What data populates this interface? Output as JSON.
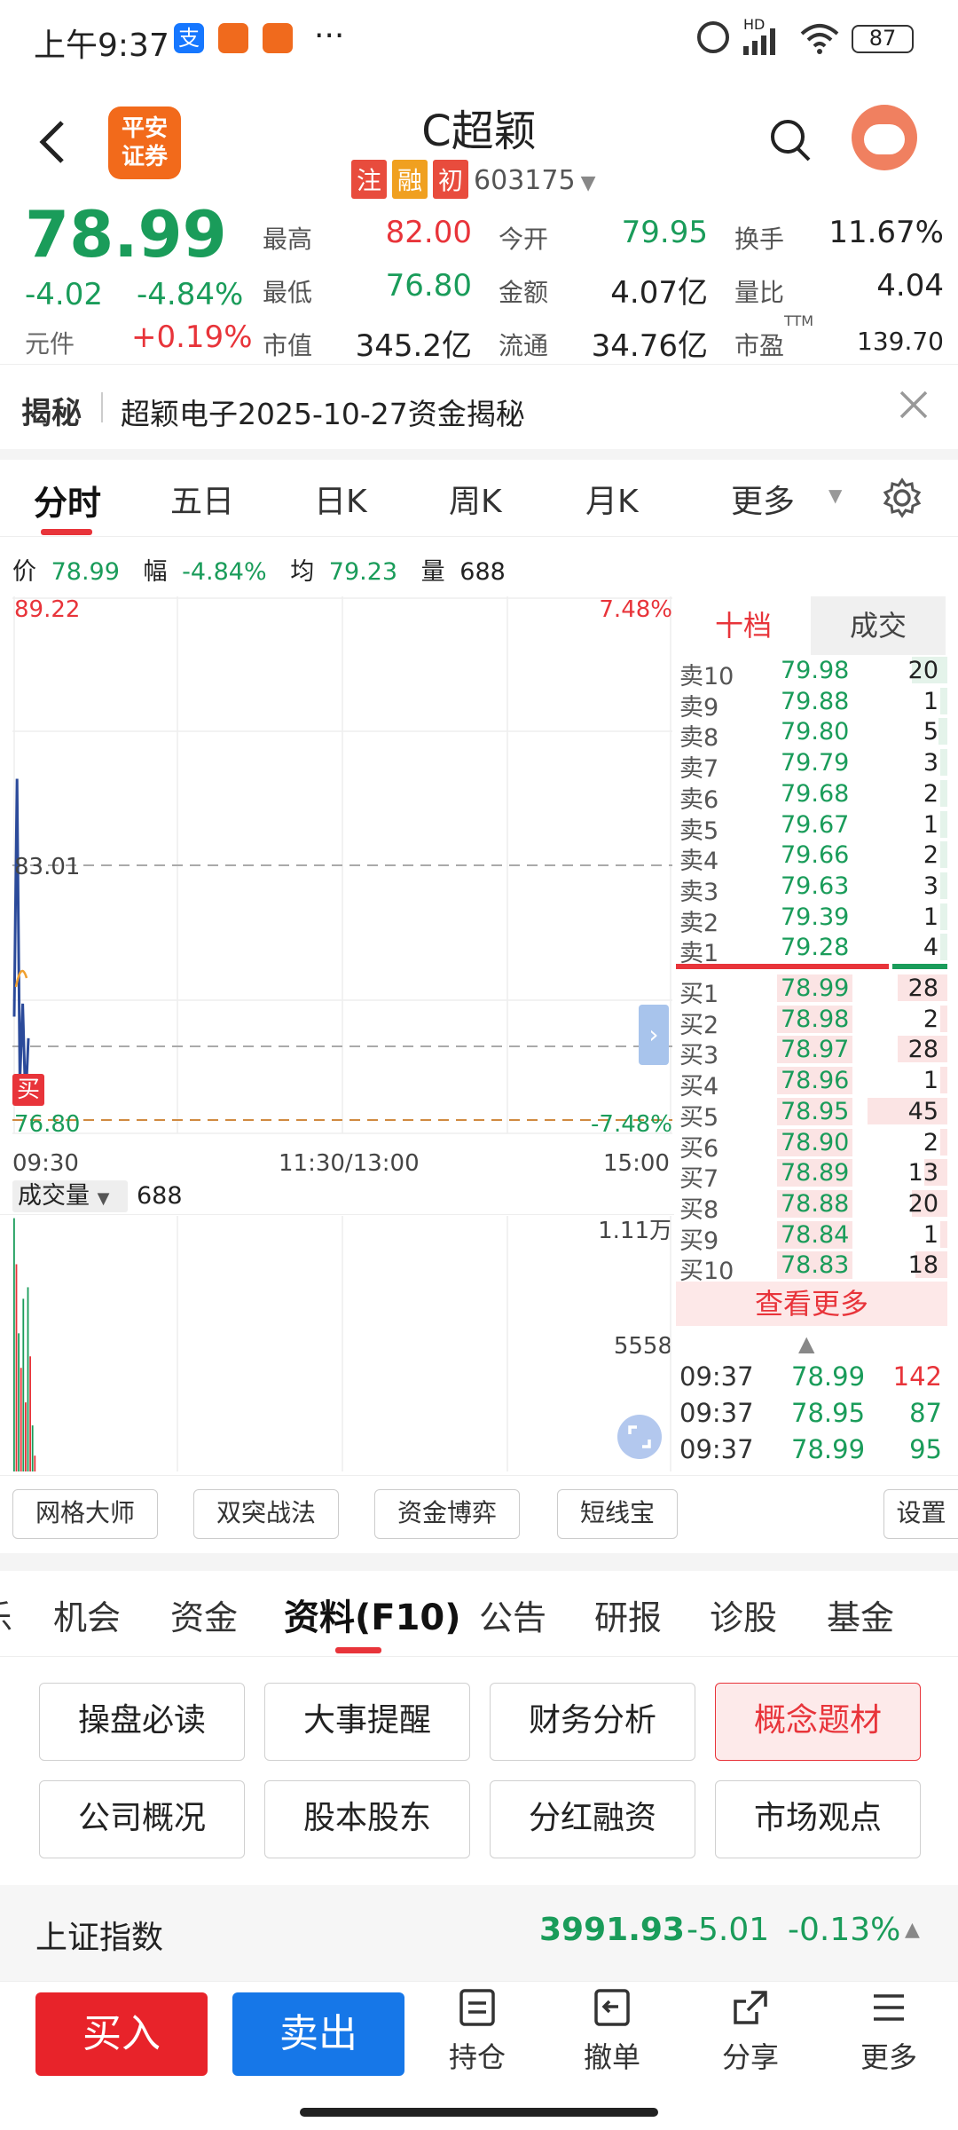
{
  "status_bar": {
    "time": "上午9:37",
    "more": "···",
    "battery": "87",
    "hd": "HD"
  },
  "header": {
    "logo_text": "平安\n证券",
    "logo_line1": "平安",
    "logo_line2": "证券",
    "title": "C超颖",
    "tags": [
      "注",
      "融",
      "初"
    ],
    "code": "603175"
  },
  "quote": {
    "price": "78.99",
    "change": "-4.02",
    "change_pct": "-4.84%",
    "unit_label": "元件",
    "unit_value": "+0.19%",
    "fields": [
      {
        "label": "最高",
        "value": "82.00"
      },
      {
        "label": "今开",
        "value": "79.95"
      },
      {
        "label": "换手",
        "value": "11.67%"
      },
      {
        "label": "最低",
        "value": "76.80"
      },
      {
        "label": "金额",
        "value": "4.07亿"
      },
      {
        "label": "量比",
        "value": "4.04"
      },
      {
        "label": "市值",
        "value": "345.2亿"
      },
      {
        "label": "流通",
        "value": "34.76亿"
      },
      {
        "label": "市盈",
        "value": "139.70",
        "sup": "TTM"
      }
    ]
  },
  "reveal": {
    "label": "揭秘",
    "text": "超颖电子2025-10-27资金揭秘"
  },
  "chart_tabs": [
    "分时",
    "五日",
    "日K",
    "周K",
    "月K",
    "更多"
  ],
  "info_line": {
    "price_label": "价",
    "price": "78.99",
    "amp_label": "幅",
    "amp": "-4.84%",
    "avg_label": "均",
    "avg": "79.23",
    "vol_label": "量",
    "vol": "688"
  },
  "chart": {
    "top_price": "89.22",
    "top_pct": "7.48%",
    "mid_price": "83.01",
    "low_price": "76.80",
    "low_pct": "-7.48%",
    "buy_marker": "买",
    "time_labels": [
      "09:30",
      "11:30/13:00",
      "15:00"
    ],
    "volume_label": "成交量",
    "volume_value": "688",
    "vol_top": "1.11万",
    "vol_mid": "5558"
  },
  "chart_data": {
    "type": "line",
    "series": [
      {
        "values": [
          79.5,
          85.0,
          78.0,
          79.8,
          77.5,
          79.0
        ]
      }
    ],
    "volumes": [
      11000,
      9000,
      6000,
      4500,
      7500,
      3000,
      8000,
      5000,
      2000,
      688
    ]
  },
  "orderbook": {
    "tabs": [
      "十档",
      "成交"
    ],
    "asks": [
      {
        "label": "卖10",
        "price": "79.98",
        "vol": "20"
      },
      {
        "label": "卖9",
        "price": "79.88",
        "vol": "1"
      },
      {
        "label": "卖8",
        "price": "79.80",
        "vol": "5"
      },
      {
        "label": "卖7",
        "price": "79.79",
        "vol": "3"
      },
      {
        "label": "卖6",
        "price": "79.68",
        "vol": "2"
      },
      {
        "label": "卖5",
        "price": "79.67",
        "vol": "1"
      },
      {
        "label": "卖4",
        "price": "79.66",
        "vol": "2"
      },
      {
        "label": "卖3",
        "price": "79.63",
        "vol": "3"
      },
      {
        "label": "卖2",
        "price": "79.39",
        "vol": "1"
      },
      {
        "label": "卖1",
        "price": "79.28",
        "vol": "4"
      }
    ],
    "bids": [
      {
        "label": "买1",
        "price": "78.99",
        "vol": "28"
      },
      {
        "label": "买2",
        "price": "78.98",
        "vol": "2"
      },
      {
        "label": "买3",
        "price": "78.97",
        "vol": "28"
      },
      {
        "label": "买4",
        "price": "78.96",
        "vol": "1"
      },
      {
        "label": "买5",
        "price": "78.95",
        "vol": "45"
      },
      {
        "label": "买6",
        "price": "78.90",
        "vol": "2"
      },
      {
        "label": "买7",
        "price": "78.89",
        "vol": "13"
      },
      {
        "label": "买8",
        "price": "78.88",
        "vol": "20"
      },
      {
        "label": "买9",
        "price": "78.84",
        "vol": "1"
      },
      {
        "label": "买10",
        "price": "78.83",
        "vol": "18"
      }
    ],
    "more": "查看更多",
    "trades": [
      {
        "time": "09:37",
        "price": "78.99",
        "vol": "142"
      },
      {
        "time": "09:37",
        "price": "78.95",
        "vol": "87"
      },
      {
        "time": "09:37",
        "price": "78.99",
        "vol": "95"
      }
    ]
  },
  "tools": [
    "网格大师",
    "双突战法",
    "资金博弈",
    "短线宝",
    "设置"
  ],
  "section_tabs": [
    "乐",
    "机会",
    "资金",
    "资料(F10)",
    "公告",
    "研报",
    "诊股",
    "基金"
  ],
  "f10_buttons": [
    "操盘必读",
    "大事提醒",
    "财务分析",
    "概念题材",
    "公司概况",
    "股本股东",
    "分红融资",
    "市场观点"
  ],
  "index": {
    "name": "上证指数",
    "value": "3991.93",
    "change": "-5.01",
    "pct": "-0.13%"
  },
  "bottom_bar": {
    "buy": "买入",
    "sell": "卖出",
    "items": [
      "持仓",
      "撤单",
      "分享",
      "更多"
    ]
  },
  "colors": {
    "up": "#e8343a",
    "down": "#1a9c5a",
    "buy_btn": "#e8232a",
    "sell_btn": "#1677e8",
    "avg_line": "#f0a030",
    "price_line": "#2b4a9a"
  }
}
